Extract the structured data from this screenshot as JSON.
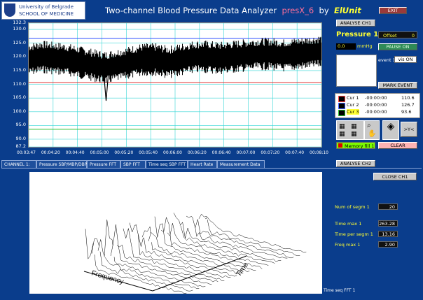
{
  "header": {
    "logo_line1": "University of Belgrade",
    "logo_line2": "SCHOOL OF MEDICINE",
    "title_main": "Two-channel Blood Pressure Data Analyzer",
    "title_version": "presX_6",
    "title_by": "by",
    "title_author": "ElUnit"
  },
  "buttons": {
    "exit": "EXIT",
    "analyse_ch1": "ANALYSE CH1",
    "pause": "PAUSE ON",
    "mark_event": "MARK EVENT",
    "clear": "CLEAR",
    "analyse_ch2": "ANALYSE CH2",
    "close_ch1": "CLOSE CH1",
    "zoom_label": ">Y<"
  },
  "pressure_panel": {
    "label": "Pressure 1",
    "offset_label": "Offset",
    "offset_value": "0",
    "pressure_value": "0.0",
    "unit": "mmHg",
    "event_label": "event 1",
    "event_select": "vis ON",
    "memory": "Memory fill 1"
  },
  "cursors": [
    {
      "name": "Cur 1",
      "time": "-00:00:00",
      "value": "110.6"
    },
    {
      "name": "Cur 2",
      "time": "-00:00:00",
      "value": "126.7"
    },
    {
      "name": "Cur 3",
      "time": "-00:00:00",
      "value": "93.6"
    }
  ],
  "chart_data": {
    "type": "line",
    "title": "",
    "xlabel": "",
    "ylabel": "",
    "y_ticks": [
      "132.3",
      "130.0",
      "125.0",
      "120.0",
      "115.0",
      "110.0",
      "105.0",
      "100.0",
      "95.0",
      "90.0",
      "87.2"
    ],
    "x_ticks": [
      "00:03:47",
      "00:04:20",
      "00:04:40",
      "00:05:00",
      "00:05:20",
      "00:05:40",
      "00:06:00",
      "00:06:20",
      "00:06:40",
      "00:07:00",
      "00:07:20",
      "00:07:40",
      "00:08:10"
    ],
    "ylim": [
      87.2,
      132.3
    ],
    "grid": true,
    "cursor_levels": [
      110.6,
      126.7,
      93.6
    ],
    "series": [
      {
        "values": [
          119,
          120,
          119.5,
          119,
          118,
          117,
          116,
          117,
          118,
          119,
          119,
          118,
          119,
          120,
          120,
          119.5,
          120,
          120.5,
          121,
          121,
          120.5,
          121,
          121.5,
          122
        ]
      }
    ]
  },
  "tabs": [
    {
      "label": "CHANNEL 1:"
    },
    {
      "label": "Pressure SBP/MBP/DBP"
    },
    {
      "label": "Pressure FFT"
    },
    {
      "label": "SBP FFT"
    },
    {
      "label": "Time seq SBP FFT"
    },
    {
      "label": "Heart Rate"
    },
    {
      "label": "Measurement Data"
    }
  ],
  "fft_plot": {
    "x_axis": "Frequency",
    "y_axis": "Time",
    "caption": "Time seq FFT 1"
  },
  "stats": [
    {
      "label": "Num of segm 1",
      "value": "20"
    },
    {
      "label": "Time max 1",
      "value": "263.28"
    },
    {
      "label": "Time per segm 1",
      "value": "13.16"
    },
    {
      "label": "Freq max 1",
      "value": "2.90"
    }
  ]
}
